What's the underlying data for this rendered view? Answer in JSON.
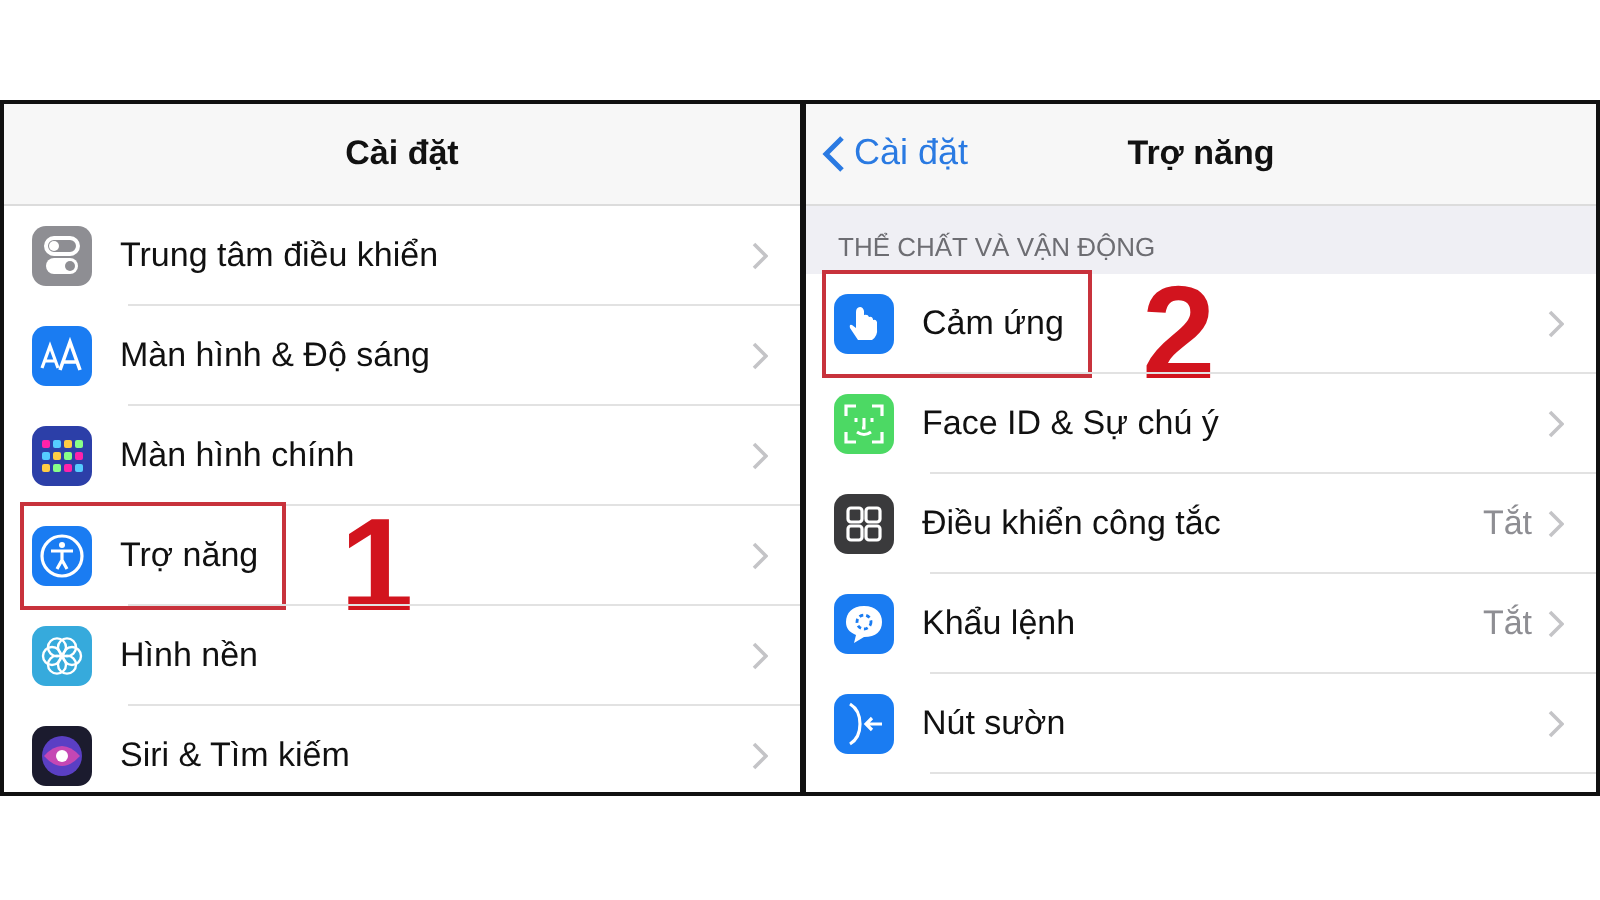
{
  "panels": [
    {
      "title": "Cài đặt",
      "rows": [
        {
          "label": "Trung tâm điều khiển",
          "highlighted": false
        },
        {
          "label": "Màn hình & Độ sáng",
          "highlighted": false
        },
        {
          "label": "Màn hình chính",
          "highlighted": false
        },
        {
          "label": "Trợ năng",
          "highlighted": true,
          "step": "1"
        },
        {
          "label": "Hình nền",
          "highlighted": false
        },
        {
          "label": "Siri & Tìm kiếm",
          "highlighted": false
        }
      ]
    },
    {
      "title": "Trợ năng",
      "back": "Cài đặt",
      "section": "THỂ CHẤT VÀ VẬN ĐỘNG",
      "rows": [
        {
          "label": "Cảm ứng",
          "highlighted": true,
          "step": "2"
        },
        {
          "label": "Face ID & Sự chú ý",
          "highlighted": false
        },
        {
          "label": "Điều khiển công tắc",
          "value": "Tắt",
          "highlighted": false
        },
        {
          "label": "Khẩu lệnh",
          "value": "Tắt",
          "highlighted": false
        },
        {
          "label": "Nút sườn",
          "highlighted": false
        }
      ]
    }
  ]
}
